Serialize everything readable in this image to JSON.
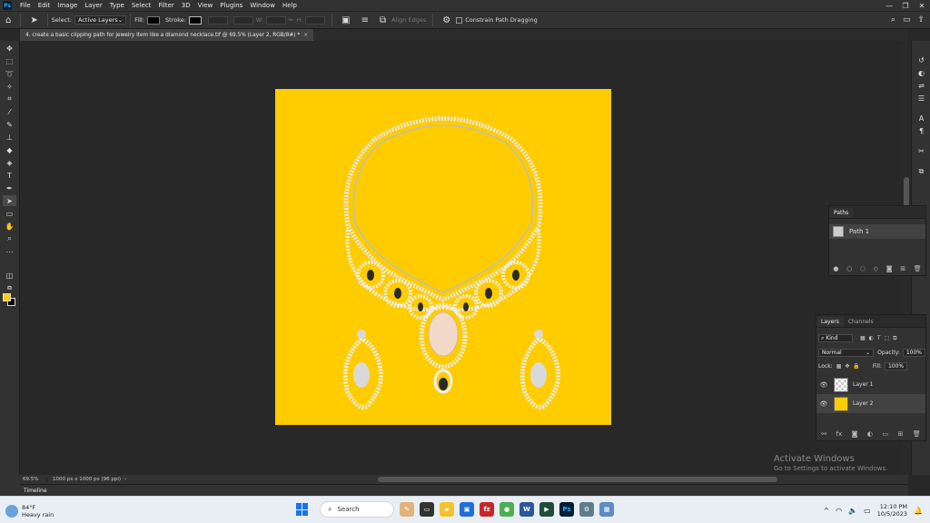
{
  "app": {
    "name": "Photoshop",
    "logo_text": "Ps",
    "menu": [
      "File",
      "Edit",
      "Image",
      "Layer",
      "Type",
      "Select",
      "Filter",
      "3D",
      "View",
      "Plugins",
      "Window",
      "Help"
    ]
  },
  "options_bar": {
    "select_label": "Select:",
    "select_value": "Active Layers",
    "fill_label": "Fill:",
    "stroke_label": "Stroke:",
    "w_label": "W:",
    "h_label": "H:",
    "align_edges": "Align Edges",
    "constrain": "Constrain Path Dragging"
  },
  "document": {
    "tab_title": "4. create a basic clipping path for jewelry item like a diamond necklace.tif @ 69.5% (Layer 2, RGB/8#) *",
    "close": "×",
    "canvas_color": "#ffcc00"
  },
  "colors": {
    "foreground": "#ffcc00",
    "background": "#000000"
  },
  "paths_panel": {
    "tab": "Paths",
    "items": [
      {
        "name": "Path 1"
      }
    ]
  },
  "layers_panel": {
    "tabs": [
      "Layers",
      "Channels"
    ],
    "kind": "Kind",
    "blend_mode": "Normal",
    "opacity_label": "Opacity:",
    "opacity_value": "100%",
    "lock_label": "Lock:",
    "fill_label": "Fill:",
    "fill_value": "100%",
    "layers": [
      {
        "name": "Layer 1",
        "selected": false
      },
      {
        "name": "Layer 2",
        "selected": true
      }
    ],
    "fx": "fx"
  },
  "status": {
    "zoom": "69.5%",
    "doc_info": "1000 px x 1000 px (96 ppi)"
  },
  "timeline": "Timeline",
  "watermark": {
    "title": "Activate Windows",
    "subtitle": "Go to Settings to activate Windows."
  },
  "taskbar": {
    "temp": "84°F",
    "weather": "Heavy rain",
    "search": "Search",
    "time": "12:10 PM",
    "date": "10/5/2023"
  }
}
